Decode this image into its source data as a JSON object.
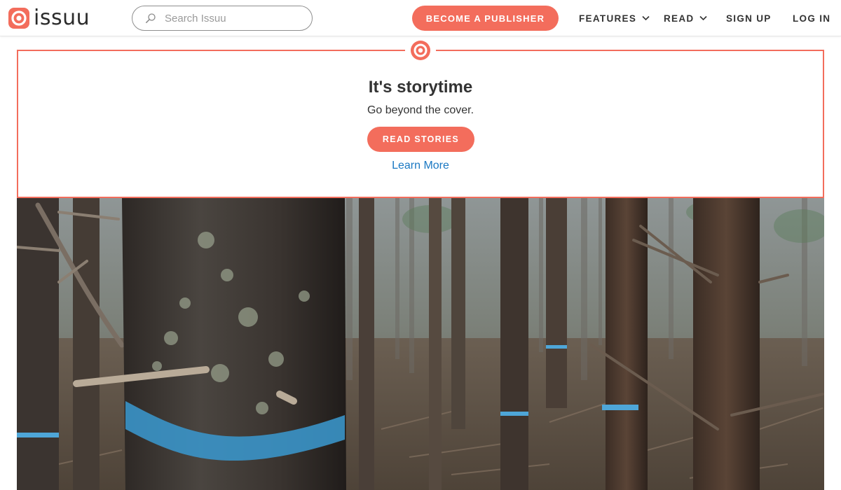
{
  "brand": {
    "name": "issuu",
    "accent_color": "#f36d5c",
    "logo_icon": "issuu-logo-icon"
  },
  "header": {
    "search": {
      "placeholder": "Search Issuu",
      "value": "",
      "icon": "search-icon"
    },
    "publisher_button": "BECOME A PUBLISHER",
    "nav": {
      "features": "FEATURES",
      "read": "READ",
      "signup": "SIGN UP",
      "login": "LOG IN"
    }
  },
  "promo": {
    "badge_icon": "issuu-badge-icon",
    "title": "It's storytime",
    "subtitle": "Go beyond the cover.",
    "cta": "READ STORIES",
    "link": "Learn More",
    "border_color": "#f36d5c",
    "link_color": "#1a78c2"
  },
  "hero": {
    "image": "forest-photo"
  }
}
